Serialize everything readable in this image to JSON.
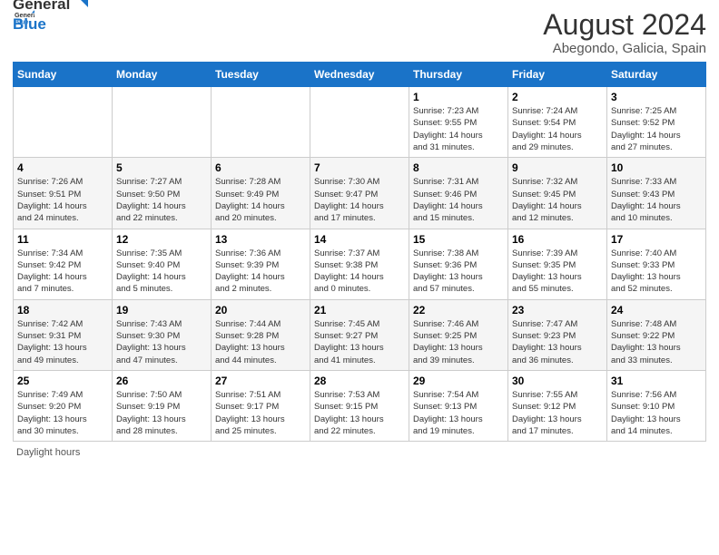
{
  "header": {
    "logo_line1": "General",
    "logo_line2": "Blue",
    "title": "August 2024",
    "subtitle": "Abegondo, Galicia, Spain"
  },
  "weekdays": [
    "Sunday",
    "Monday",
    "Tuesday",
    "Wednesday",
    "Thursday",
    "Friday",
    "Saturday"
  ],
  "footer": {
    "label": "Daylight hours"
  },
  "weeks": [
    [
      {
        "day": "",
        "info": ""
      },
      {
        "day": "",
        "info": ""
      },
      {
        "day": "",
        "info": ""
      },
      {
        "day": "",
        "info": ""
      },
      {
        "day": "1",
        "info": "Sunrise: 7:23 AM\nSunset: 9:55 PM\nDaylight: 14 hours\nand 31 minutes."
      },
      {
        "day": "2",
        "info": "Sunrise: 7:24 AM\nSunset: 9:54 PM\nDaylight: 14 hours\nand 29 minutes."
      },
      {
        "day": "3",
        "info": "Sunrise: 7:25 AM\nSunset: 9:52 PM\nDaylight: 14 hours\nand 27 minutes."
      }
    ],
    [
      {
        "day": "4",
        "info": "Sunrise: 7:26 AM\nSunset: 9:51 PM\nDaylight: 14 hours\nand 24 minutes."
      },
      {
        "day": "5",
        "info": "Sunrise: 7:27 AM\nSunset: 9:50 PM\nDaylight: 14 hours\nand 22 minutes."
      },
      {
        "day": "6",
        "info": "Sunrise: 7:28 AM\nSunset: 9:49 PM\nDaylight: 14 hours\nand 20 minutes."
      },
      {
        "day": "7",
        "info": "Sunrise: 7:30 AM\nSunset: 9:47 PM\nDaylight: 14 hours\nand 17 minutes."
      },
      {
        "day": "8",
        "info": "Sunrise: 7:31 AM\nSunset: 9:46 PM\nDaylight: 14 hours\nand 15 minutes."
      },
      {
        "day": "9",
        "info": "Sunrise: 7:32 AM\nSunset: 9:45 PM\nDaylight: 14 hours\nand 12 minutes."
      },
      {
        "day": "10",
        "info": "Sunrise: 7:33 AM\nSunset: 9:43 PM\nDaylight: 14 hours\nand 10 minutes."
      }
    ],
    [
      {
        "day": "11",
        "info": "Sunrise: 7:34 AM\nSunset: 9:42 PM\nDaylight: 14 hours\nand 7 minutes."
      },
      {
        "day": "12",
        "info": "Sunrise: 7:35 AM\nSunset: 9:40 PM\nDaylight: 14 hours\nand 5 minutes."
      },
      {
        "day": "13",
        "info": "Sunrise: 7:36 AM\nSunset: 9:39 PM\nDaylight: 14 hours\nand 2 minutes."
      },
      {
        "day": "14",
        "info": "Sunrise: 7:37 AM\nSunset: 9:38 PM\nDaylight: 14 hours\nand 0 minutes."
      },
      {
        "day": "15",
        "info": "Sunrise: 7:38 AM\nSunset: 9:36 PM\nDaylight: 13 hours\nand 57 minutes."
      },
      {
        "day": "16",
        "info": "Sunrise: 7:39 AM\nSunset: 9:35 PM\nDaylight: 13 hours\nand 55 minutes."
      },
      {
        "day": "17",
        "info": "Sunrise: 7:40 AM\nSunset: 9:33 PM\nDaylight: 13 hours\nand 52 minutes."
      }
    ],
    [
      {
        "day": "18",
        "info": "Sunrise: 7:42 AM\nSunset: 9:31 PM\nDaylight: 13 hours\nand 49 minutes."
      },
      {
        "day": "19",
        "info": "Sunrise: 7:43 AM\nSunset: 9:30 PM\nDaylight: 13 hours\nand 47 minutes."
      },
      {
        "day": "20",
        "info": "Sunrise: 7:44 AM\nSunset: 9:28 PM\nDaylight: 13 hours\nand 44 minutes."
      },
      {
        "day": "21",
        "info": "Sunrise: 7:45 AM\nSunset: 9:27 PM\nDaylight: 13 hours\nand 41 minutes."
      },
      {
        "day": "22",
        "info": "Sunrise: 7:46 AM\nSunset: 9:25 PM\nDaylight: 13 hours\nand 39 minutes."
      },
      {
        "day": "23",
        "info": "Sunrise: 7:47 AM\nSunset: 9:23 PM\nDaylight: 13 hours\nand 36 minutes."
      },
      {
        "day": "24",
        "info": "Sunrise: 7:48 AM\nSunset: 9:22 PM\nDaylight: 13 hours\nand 33 minutes."
      }
    ],
    [
      {
        "day": "25",
        "info": "Sunrise: 7:49 AM\nSunset: 9:20 PM\nDaylight: 13 hours\nand 30 minutes."
      },
      {
        "day": "26",
        "info": "Sunrise: 7:50 AM\nSunset: 9:19 PM\nDaylight: 13 hours\nand 28 minutes."
      },
      {
        "day": "27",
        "info": "Sunrise: 7:51 AM\nSunset: 9:17 PM\nDaylight: 13 hours\nand 25 minutes."
      },
      {
        "day": "28",
        "info": "Sunrise: 7:53 AM\nSunset: 9:15 PM\nDaylight: 13 hours\nand 22 minutes."
      },
      {
        "day": "29",
        "info": "Sunrise: 7:54 AM\nSunset: 9:13 PM\nDaylight: 13 hours\nand 19 minutes."
      },
      {
        "day": "30",
        "info": "Sunrise: 7:55 AM\nSunset: 9:12 PM\nDaylight: 13 hours\nand 17 minutes."
      },
      {
        "day": "31",
        "info": "Sunrise: 7:56 AM\nSunset: 9:10 PM\nDaylight: 13 hours\nand 14 minutes."
      }
    ]
  ]
}
